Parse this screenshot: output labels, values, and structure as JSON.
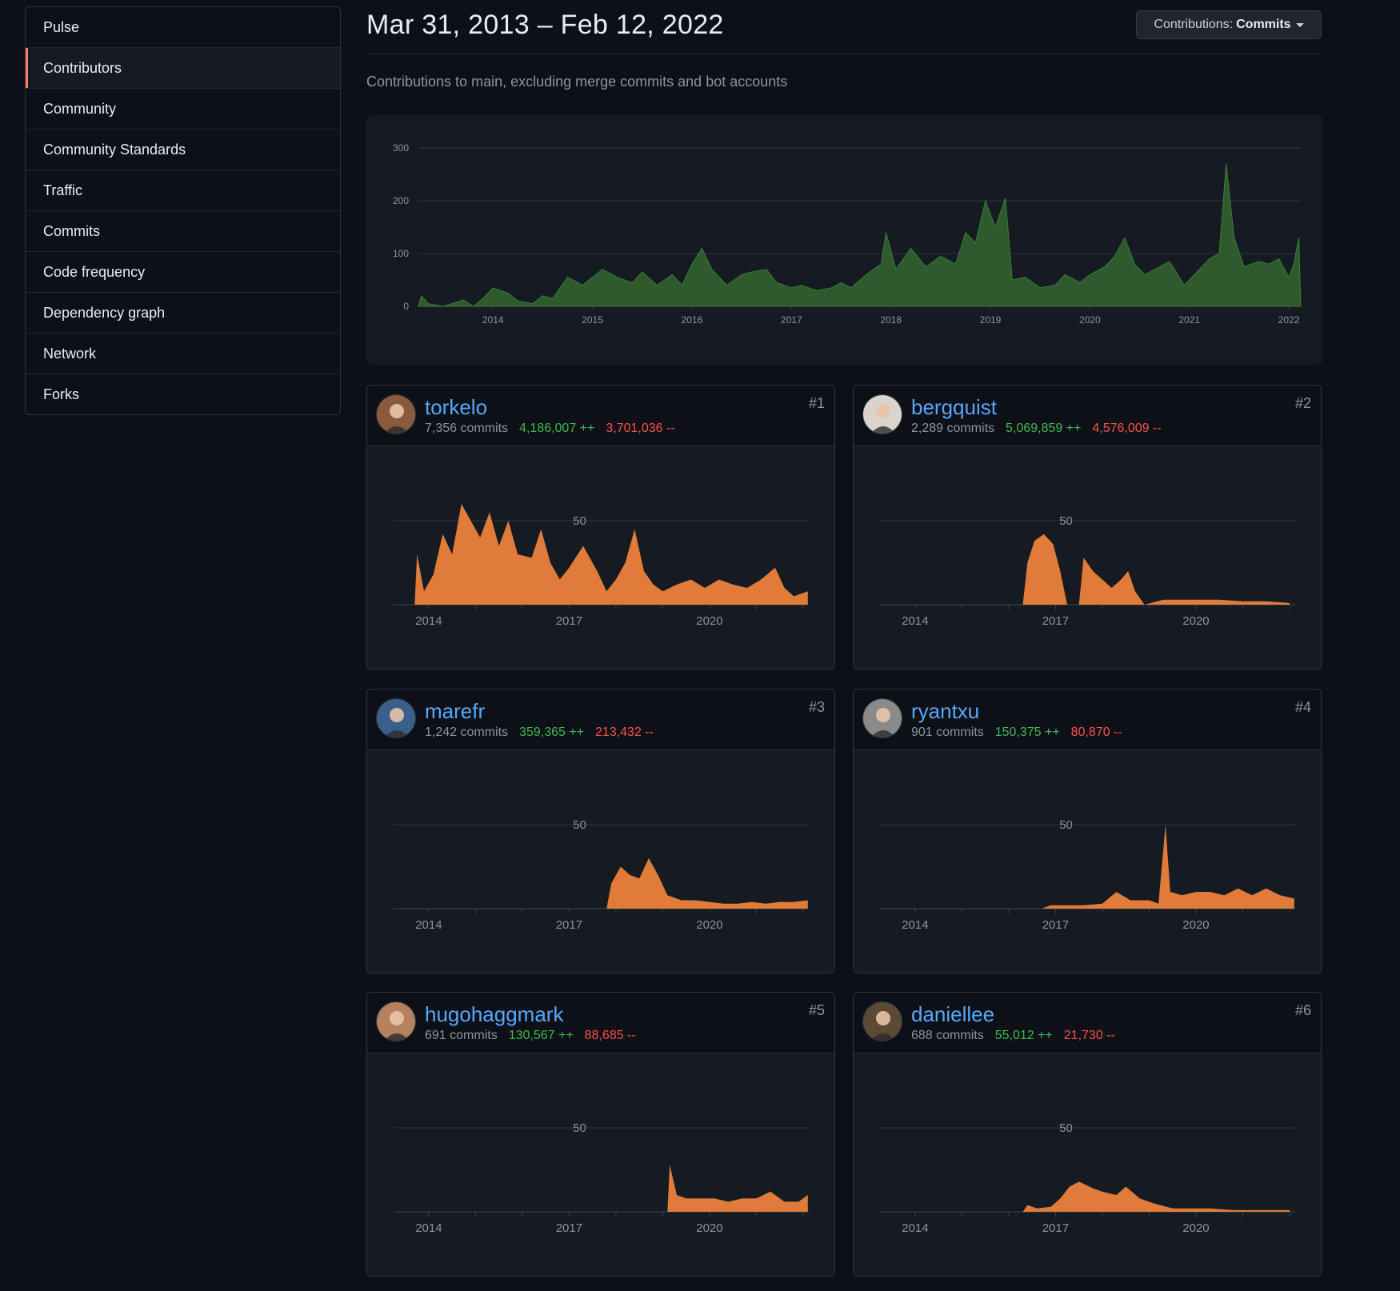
{
  "sidebar": {
    "items": [
      {
        "label": "Pulse"
      },
      {
        "label": "Contributors",
        "active": true
      },
      {
        "label": "Community"
      },
      {
        "label": "Community Standards"
      },
      {
        "label": "Traffic"
      },
      {
        "label": "Commits"
      },
      {
        "label": "Code frequency"
      },
      {
        "label": "Dependency graph"
      },
      {
        "label": "Network"
      },
      {
        "label": "Forks"
      }
    ]
  },
  "header": {
    "date_range": "Mar 31, 2013 – Feb 12, 2022",
    "contrib_prefix": "Contributions:",
    "contrib_value": "Commits",
    "subtitle": "Contributions to main, excluding merge commits and bot accounts"
  },
  "colors": {
    "main_area": "#2e5a2e",
    "contributor_area": "#e07b39",
    "additions": "#3fb950",
    "deletions": "#f85149",
    "link": "#58a6ff"
  },
  "chart_data": [
    {
      "type": "area",
      "x_ticks": [
        "2014",
        "2015",
        "2016",
        "2017",
        "2018",
        "2019",
        "2020",
        "2021",
        "2022"
      ],
      "y_ticks": [
        0,
        100,
        200,
        300
      ],
      "ylim": [
        0,
        300
      ],
      "xlim": [
        "2013-03-31",
        "2022-02-12"
      ],
      "grid": true,
      "series": [
        {
          "points": [
            [
              2013.25,
              0
            ],
            [
              2013.28,
              20
            ],
            [
              2013.35,
              5
            ],
            [
              2013.5,
              0
            ],
            [
              2013.7,
              12
            ],
            [
              2013.8,
              0
            ],
            [
              2013.9,
              15
            ],
            [
              2014.0,
              35
            ],
            [
              2014.15,
              25
            ],
            [
              2014.25,
              10
            ],
            [
              2014.4,
              5
            ],
            [
              2014.5,
              20
            ],
            [
              2014.6,
              15
            ],
            [
              2014.75,
              55
            ],
            [
              2014.9,
              40
            ],
            [
              2015.0,
              55
            ],
            [
              2015.1,
              70
            ],
            [
              2015.25,
              55
            ],
            [
              2015.4,
              45
            ],
            [
              2015.5,
              65
            ],
            [
              2015.65,
              40
            ],
            [
              2015.8,
              60
            ],
            [
              2015.9,
              40
            ],
            [
              2016.0,
              80
            ],
            [
              2016.1,
              110
            ],
            [
              2016.2,
              70
            ],
            [
              2016.35,
              40
            ],
            [
              2016.5,
              60
            ],
            [
              2016.6,
              65
            ],
            [
              2016.75,
              70
            ],
            [
              2016.85,
              45
            ],
            [
              2017.0,
              35
            ],
            [
              2017.1,
              40
            ],
            [
              2017.25,
              30
            ],
            [
              2017.4,
              35
            ],
            [
              2017.5,
              45
            ],
            [
              2017.6,
              35
            ],
            [
              2017.75,
              60
            ],
            [
              2017.9,
              80
            ],
            [
              2017.95,
              140
            ],
            [
              2018.05,
              70
            ],
            [
              2018.2,
              110
            ],
            [
              2018.35,
              75
            ],
            [
              2018.5,
              95
            ],
            [
              2018.65,
              80
            ],
            [
              2018.75,
              140
            ],
            [
              2018.85,
              120
            ],
            [
              2018.95,
              200
            ],
            [
              2019.05,
              150
            ],
            [
              2019.15,
              205
            ],
            [
              2019.22,
              50
            ],
            [
              2019.35,
              55
            ],
            [
              2019.5,
              35
            ],
            [
              2019.65,
              40
            ],
            [
              2019.75,
              60
            ],
            [
              2019.9,
              45
            ],
            [
              2020.0,
              60
            ],
            [
              2020.15,
              75
            ],
            [
              2020.25,
              95
            ],
            [
              2020.35,
              130
            ],
            [
              2020.45,
              80
            ],
            [
              2020.55,
              60
            ],
            [
              2020.65,
              70
            ],
            [
              2020.8,
              85
            ],
            [
              2020.95,
              40
            ],
            [
              2021.05,
              60
            ],
            [
              2021.2,
              90
            ],
            [
              2021.3,
              100
            ],
            [
              2021.37,
              270
            ],
            [
              2021.45,
              130
            ],
            [
              2021.55,
              75
            ],
            [
              2021.7,
              85
            ],
            [
              2021.8,
              80
            ],
            [
              2021.9,
              90
            ],
            [
              2022.0,
              55
            ],
            [
              2022.05,
              80
            ],
            [
              2022.1,
              130
            ],
            [
              2022.12,
              0
            ]
          ]
        }
      ]
    }
  ],
  "contributors": [
    {
      "rank": "#1",
      "username": "torkelo",
      "commits": "7,356 commits",
      "additions": "4,186,007 ++",
      "deletions": "3,701,036 --",
      "avatar_icon": "user-avatar-icon",
      "avatar_color": "#8a5a3c",
      "chart_data": {
        "type": "area",
        "x_ticks": [
          "2014",
          "2017",
          "2020"
        ],
        "y_tick": "50",
        "ylim": [
          0,
          50
        ],
        "grid": true,
        "points": [
          [
            2013.7,
            0
          ],
          [
            2013.75,
            30
          ],
          [
            2013.9,
            8
          ],
          [
            2014.1,
            18
          ],
          [
            2014.3,
            42
          ],
          [
            2014.5,
            30
          ],
          [
            2014.7,
            60
          ],
          [
            2014.9,
            50
          ],
          [
            2015.1,
            40
          ],
          [
            2015.3,
            55
          ],
          [
            2015.5,
            35
          ],
          [
            2015.7,
            50
          ],
          [
            2015.9,
            30
          ],
          [
            2016.2,
            28
          ],
          [
            2016.4,
            45
          ],
          [
            2016.6,
            25
          ],
          [
            2016.8,
            15
          ],
          [
            2017.0,
            22
          ],
          [
            2017.3,
            35
          ],
          [
            2017.6,
            20
          ],
          [
            2017.8,
            8
          ],
          [
            2018.0,
            15
          ],
          [
            2018.2,
            25
          ],
          [
            2018.4,
            45
          ],
          [
            2018.6,
            20
          ],
          [
            2018.8,
            12
          ],
          [
            2019.0,
            8
          ],
          [
            2019.3,
            12
          ],
          [
            2019.6,
            15
          ],
          [
            2019.9,
            10
          ],
          [
            2020.2,
            15
          ],
          [
            2020.5,
            12
          ],
          [
            2020.8,
            10
          ],
          [
            2021.1,
            15
          ],
          [
            2021.4,
            22
          ],
          [
            2021.6,
            10
          ],
          [
            2021.8,
            5
          ],
          [
            2022.1,
            8
          ]
        ]
      }
    },
    {
      "rank": "#2",
      "username": "bergquist",
      "commits": "2,289 commits",
      "additions": "5,069,859 ++",
      "deletions": "4,576,009 --",
      "avatar_icon": "user-avatar-icon",
      "avatar_color": "#d9d4cc",
      "chart_data": {
        "type": "area",
        "x_ticks": [
          "2014",
          "2017",
          "2020"
        ],
        "y_tick": "50",
        "ylim": [
          0,
          50
        ],
        "grid": true,
        "points": [
          [
            2016.3,
            0
          ],
          [
            2016.4,
            25
          ],
          [
            2016.55,
            38
          ],
          [
            2016.75,
            42
          ],
          [
            2016.95,
            36
          ],
          [
            2017.1,
            20
          ],
          [
            2017.25,
            0
          ],
          [
            2017.5,
            0
          ],
          [
            2017.6,
            28
          ],
          [
            2017.8,
            20
          ],
          [
            2018.0,
            15
          ],
          [
            2018.2,
            10
          ],
          [
            2018.4,
            15
          ],
          [
            2018.55,
            20
          ],
          [
            2018.7,
            8
          ],
          [
            2018.9,
            0
          ],
          [
            2019.3,
            3
          ],
          [
            2019.6,
            3
          ],
          [
            2020.0,
            3
          ],
          [
            2020.5,
            3
          ],
          [
            2021.0,
            2
          ],
          [
            2021.5,
            2
          ],
          [
            2022.0,
            1
          ]
        ]
      }
    },
    {
      "rank": "#3",
      "username": "marefr",
      "commits": "1,242 commits",
      "additions": "359,365 ++",
      "deletions": "213,432 --",
      "avatar_icon": "user-avatar-icon",
      "avatar_color": "#3a5f8a",
      "chart_data": {
        "type": "area",
        "x_ticks": [
          "2014",
          "2017",
          "2020"
        ],
        "y_tick": "50",
        "ylim": [
          0,
          50
        ],
        "grid": true,
        "points": [
          [
            2017.8,
            0
          ],
          [
            2017.9,
            15
          ],
          [
            2018.1,
            25
          ],
          [
            2018.3,
            20
          ],
          [
            2018.5,
            18
          ],
          [
            2018.7,
            30
          ],
          [
            2018.9,
            20
          ],
          [
            2019.1,
            8
          ],
          [
            2019.4,
            5
          ],
          [
            2019.7,
            5
          ],
          [
            2020.0,
            4
          ],
          [
            2020.3,
            3
          ],
          [
            2020.6,
            3
          ],
          [
            2020.9,
            4
          ],
          [
            2021.2,
            3
          ],
          [
            2021.5,
            4
          ],
          [
            2021.8,
            4
          ],
          [
            2022.1,
            5
          ]
        ]
      }
    },
    {
      "rank": "#4",
      "username": "ryantxu",
      "commits": "901 commits",
      "additions": "150,375 ++",
      "deletions": "80,870 --",
      "avatar_icon": "user-avatar-icon",
      "avatar_color": "#8a8a8a",
      "chart_data": {
        "type": "area",
        "x_ticks": [
          "2014",
          "2017",
          "2020"
        ],
        "y_tick": "50",
        "ylim": [
          0,
          50
        ],
        "grid": true,
        "points": [
          [
            2016.7,
            0
          ],
          [
            2016.9,
            2
          ],
          [
            2017.2,
            2
          ],
          [
            2017.6,
            2
          ],
          [
            2018.0,
            3
          ],
          [
            2018.3,
            10
          ],
          [
            2018.6,
            5
          ],
          [
            2019.0,
            5
          ],
          [
            2019.2,
            3
          ],
          [
            2019.35,
            50
          ],
          [
            2019.45,
            10
          ],
          [
            2019.7,
            8
          ],
          [
            2020.0,
            10
          ],
          [
            2020.3,
            10
          ],
          [
            2020.6,
            8
          ],
          [
            2020.9,
            12
          ],
          [
            2021.2,
            8
          ],
          [
            2021.5,
            12
          ],
          [
            2021.8,
            8
          ],
          [
            2022.1,
            6
          ]
        ]
      }
    },
    {
      "rank": "#5",
      "username": "hugohaggmark",
      "commits": "691 commits",
      "additions": "130,567 ++",
      "deletions": "88,685 --",
      "avatar_icon": "user-avatar-icon",
      "avatar_color": "#b5815f",
      "chart_data": {
        "type": "area",
        "x_ticks": [
          "2014",
          "2017",
          "2020"
        ],
        "y_tick": "50",
        "ylim": [
          0,
          50
        ],
        "grid": true,
        "points": [
          [
            2019.1,
            0
          ],
          [
            2019.15,
            28
          ],
          [
            2019.3,
            10
          ],
          [
            2019.5,
            8
          ],
          [
            2019.8,
            8
          ],
          [
            2020.1,
            8
          ],
          [
            2020.4,
            6
          ],
          [
            2020.7,
            8
          ],
          [
            2021.0,
            8
          ],
          [
            2021.3,
            12
          ],
          [
            2021.6,
            6
          ],
          [
            2021.9,
            6
          ],
          [
            2022.1,
            10
          ]
        ]
      }
    },
    {
      "rank": "#6",
      "username": "daniellee",
      "commits": "688 commits",
      "additions": "55,012 ++",
      "deletions": "21,730 --",
      "avatar_icon": "user-avatar-icon",
      "avatar_color": "#5c4a36",
      "chart_data": {
        "type": "area",
        "x_ticks": [
          "2014",
          "2017",
          "2020"
        ],
        "y_tick": "50",
        "ylim": [
          0,
          50
        ],
        "grid": true,
        "points": [
          [
            2016.3,
            0
          ],
          [
            2016.4,
            4
          ],
          [
            2016.6,
            2
          ],
          [
            2016.9,
            3
          ],
          [
            2017.1,
            8
          ],
          [
            2017.3,
            15
          ],
          [
            2017.5,
            18
          ],
          [
            2017.8,
            14
          ],
          [
            2018.0,
            12
          ],
          [
            2018.3,
            10
          ],
          [
            2018.5,
            15
          ],
          [
            2018.8,
            8
          ],
          [
            2019.1,
            5
          ],
          [
            2019.5,
            2
          ],
          [
            2020.0,
            2
          ],
          [
            2020.3,
            2
          ],
          [
            2020.8,
            1
          ],
          [
            2021.2,
            1
          ],
          [
            2022.0,
            1
          ]
        ]
      }
    }
  ]
}
